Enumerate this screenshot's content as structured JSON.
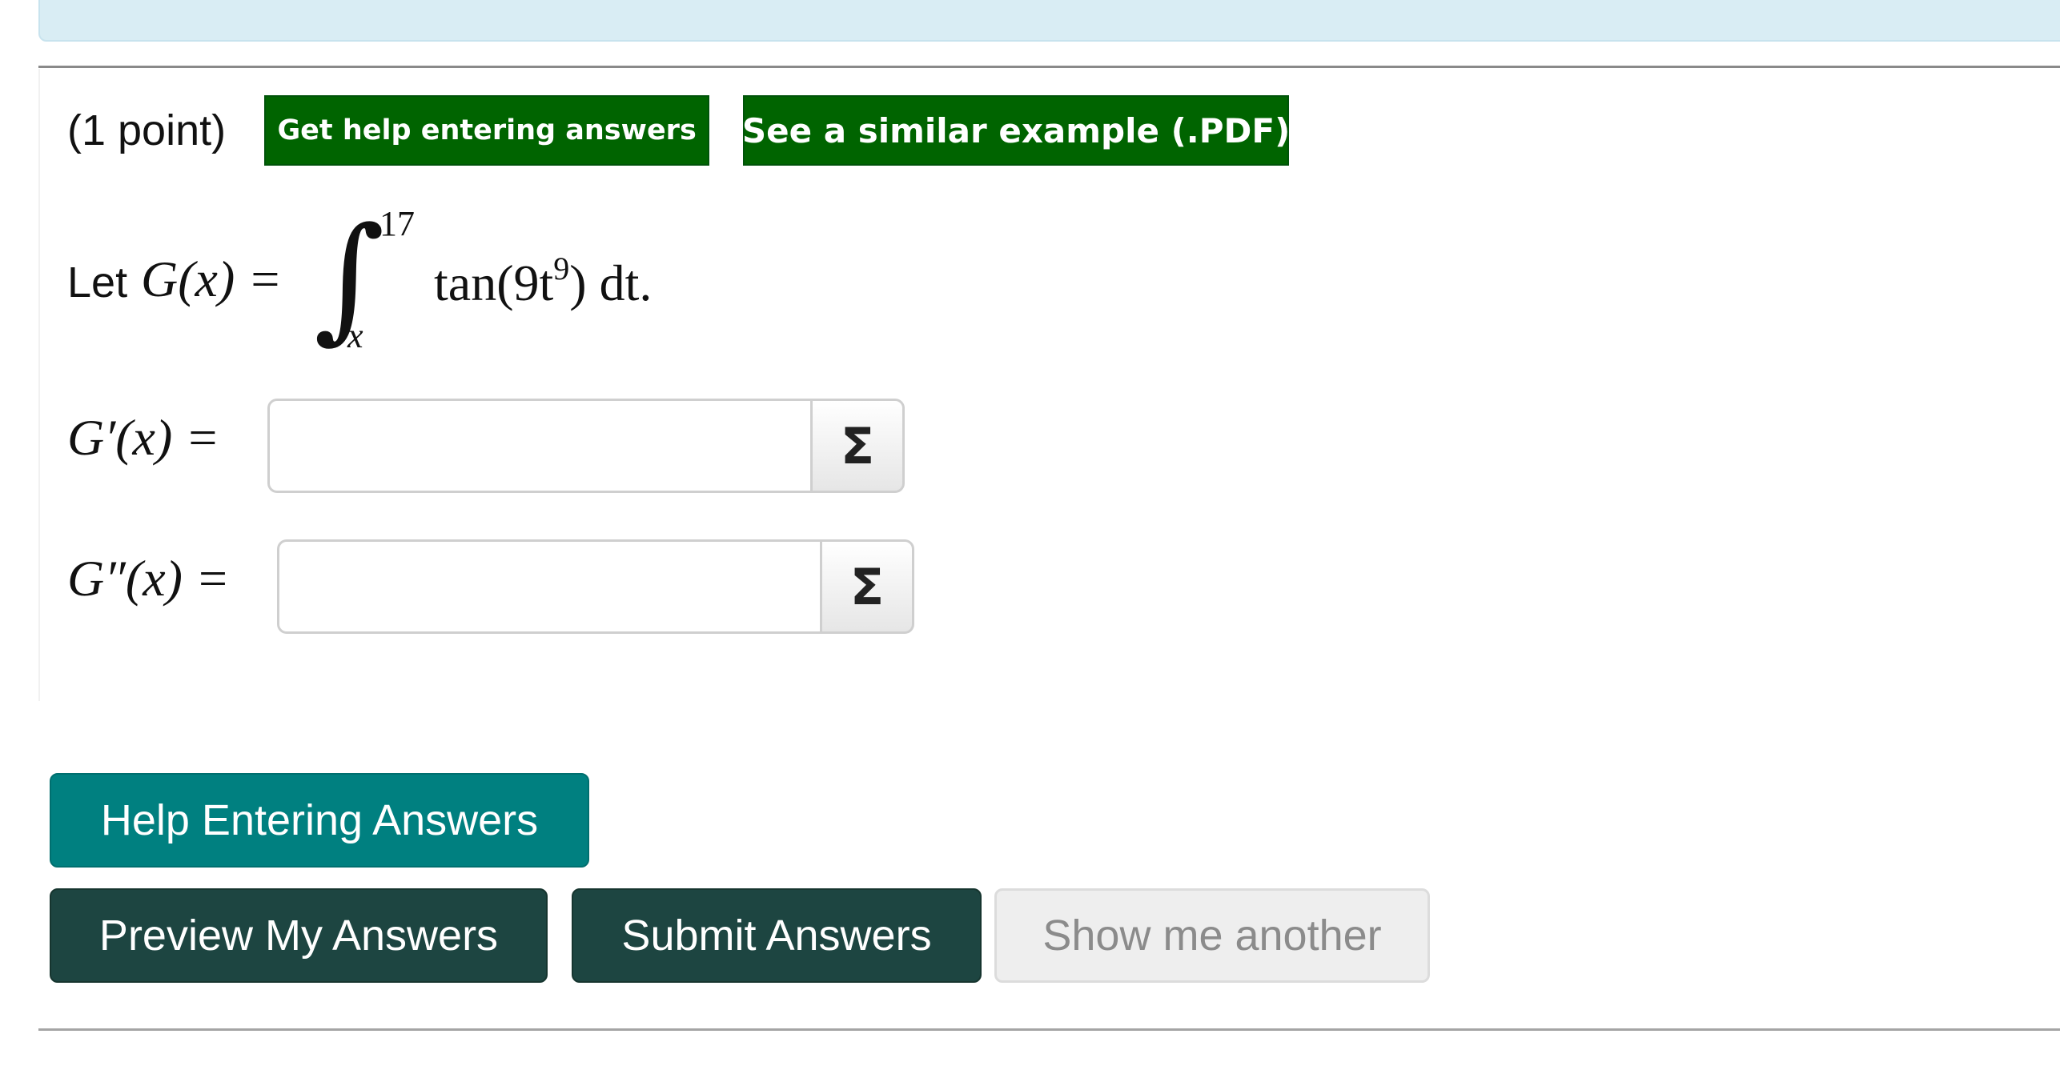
{
  "problem": {
    "points_label": "(1 point)",
    "help_link_label": "Get help entering answers",
    "example_link_label": "See a similar example (.PDF)",
    "statement": {
      "let_word": "Let",
      "lhs": "G(x) =",
      "upper_limit": "17",
      "lower_limit": "x",
      "integrand_func": "tan(9t",
      "exponent": "9",
      "integrand_tail": ") dt."
    },
    "parts": [
      {
        "label": "G′(x) =",
        "value": "",
        "equation_editor_symbol": "Σ"
      },
      {
        "label": "G″(x) =",
        "value": "",
        "equation_editor_symbol": "Σ"
      }
    ]
  },
  "actions": {
    "help_entering_answers": "Help Entering Answers",
    "preview": "Preview My Answers",
    "submit": "Submit Answers",
    "show_another": "Show me another"
  },
  "colors": {
    "green_link": "#006400",
    "teal_button": "#008080",
    "dark_button": "#1d4541",
    "disabled_button": "#eeeeee",
    "banner": "#d9edf4"
  },
  "icons": {
    "equation_editor": "sigma-icon"
  }
}
